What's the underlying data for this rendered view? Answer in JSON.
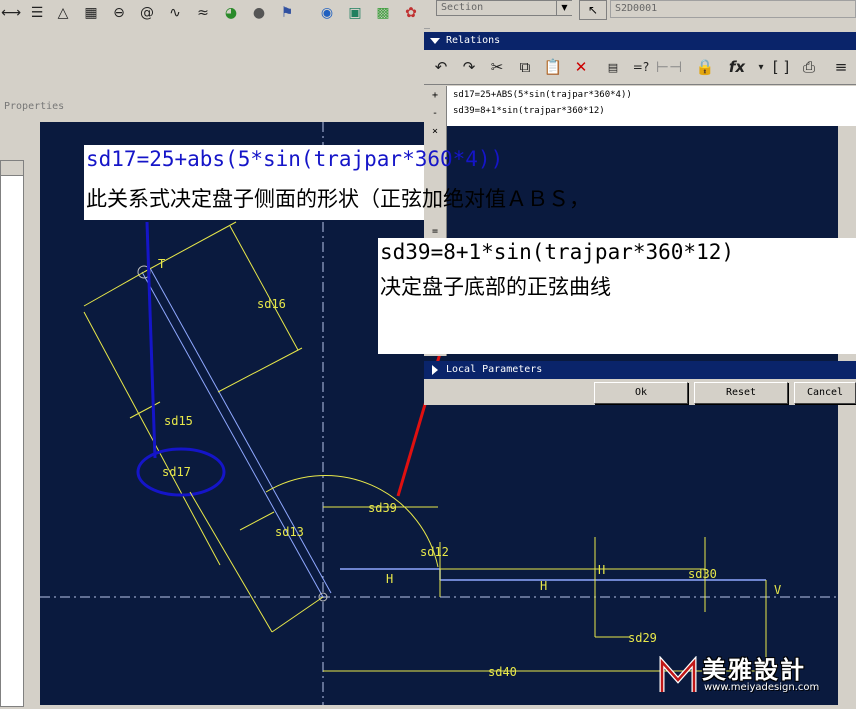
{
  "toolbar": {
    "icons": [
      "dimension-icon",
      "stack-icon",
      "triangle-icon",
      "grid-icon",
      "ellipse-icon",
      "spiral-icon",
      "curve-icon",
      "wave-icon",
      "palette-icon",
      "sphere-icon",
      "pennant-icon",
      "globe-icon",
      "map-icon",
      "green-map-icon",
      "color-wheel-icon"
    ],
    "section_placeholder": "Section",
    "section_value": "S2D0001"
  },
  "properties_label": "Properties",
  "relations": {
    "title": "Relations",
    "gutter_marks": [
      "+",
      "-",
      "×",
      "="
    ],
    "lines": [
      "sd17=25+ABS(5*sin(trajpar*360*4))",
      "sd39=8+1*sin(trajpar*360*12)"
    ],
    "fx_label": "fx"
  },
  "local_parameters": {
    "title": "Local Parameters",
    "ok_label": "Ok",
    "reset_label": "Reset",
    "cancel_label": "Cancel"
  },
  "annotations": {
    "sd17_formula": "sd17=25+abs(5*sin(trajpar*360*4))",
    "sd17_note": "此关系式决定盘子侧面的形状（正弦加绝对值ＡＢＳ，",
    "sd39_formula": "sd39=8+1*sin(trajpar*360*12)",
    "sd39_note": "决定盘子底部的正弦曲线"
  },
  "sketch": {
    "dimensions": {
      "sd16": "sd16",
      "sd15": "sd15",
      "sd17": "sd17",
      "sd13": "sd13",
      "sd39": "sd39",
      "sd12": "sd12",
      "sd30": "sd30",
      "sd29": "sd29",
      "sd40": "sd40"
    },
    "constraints": {
      "t": "T",
      "h1": "H",
      "h2": "H",
      "h3": "H",
      "v": "V"
    },
    "colors": {
      "background": "#0a1a3e",
      "dimension": "#e8e84a",
      "geometry": "#8fa8ff",
      "highlight": "#1515c8",
      "arrow": "#e01010"
    }
  },
  "watermark": {
    "text": "美雅設計",
    "url": "www.meiyadesign.com"
  }
}
